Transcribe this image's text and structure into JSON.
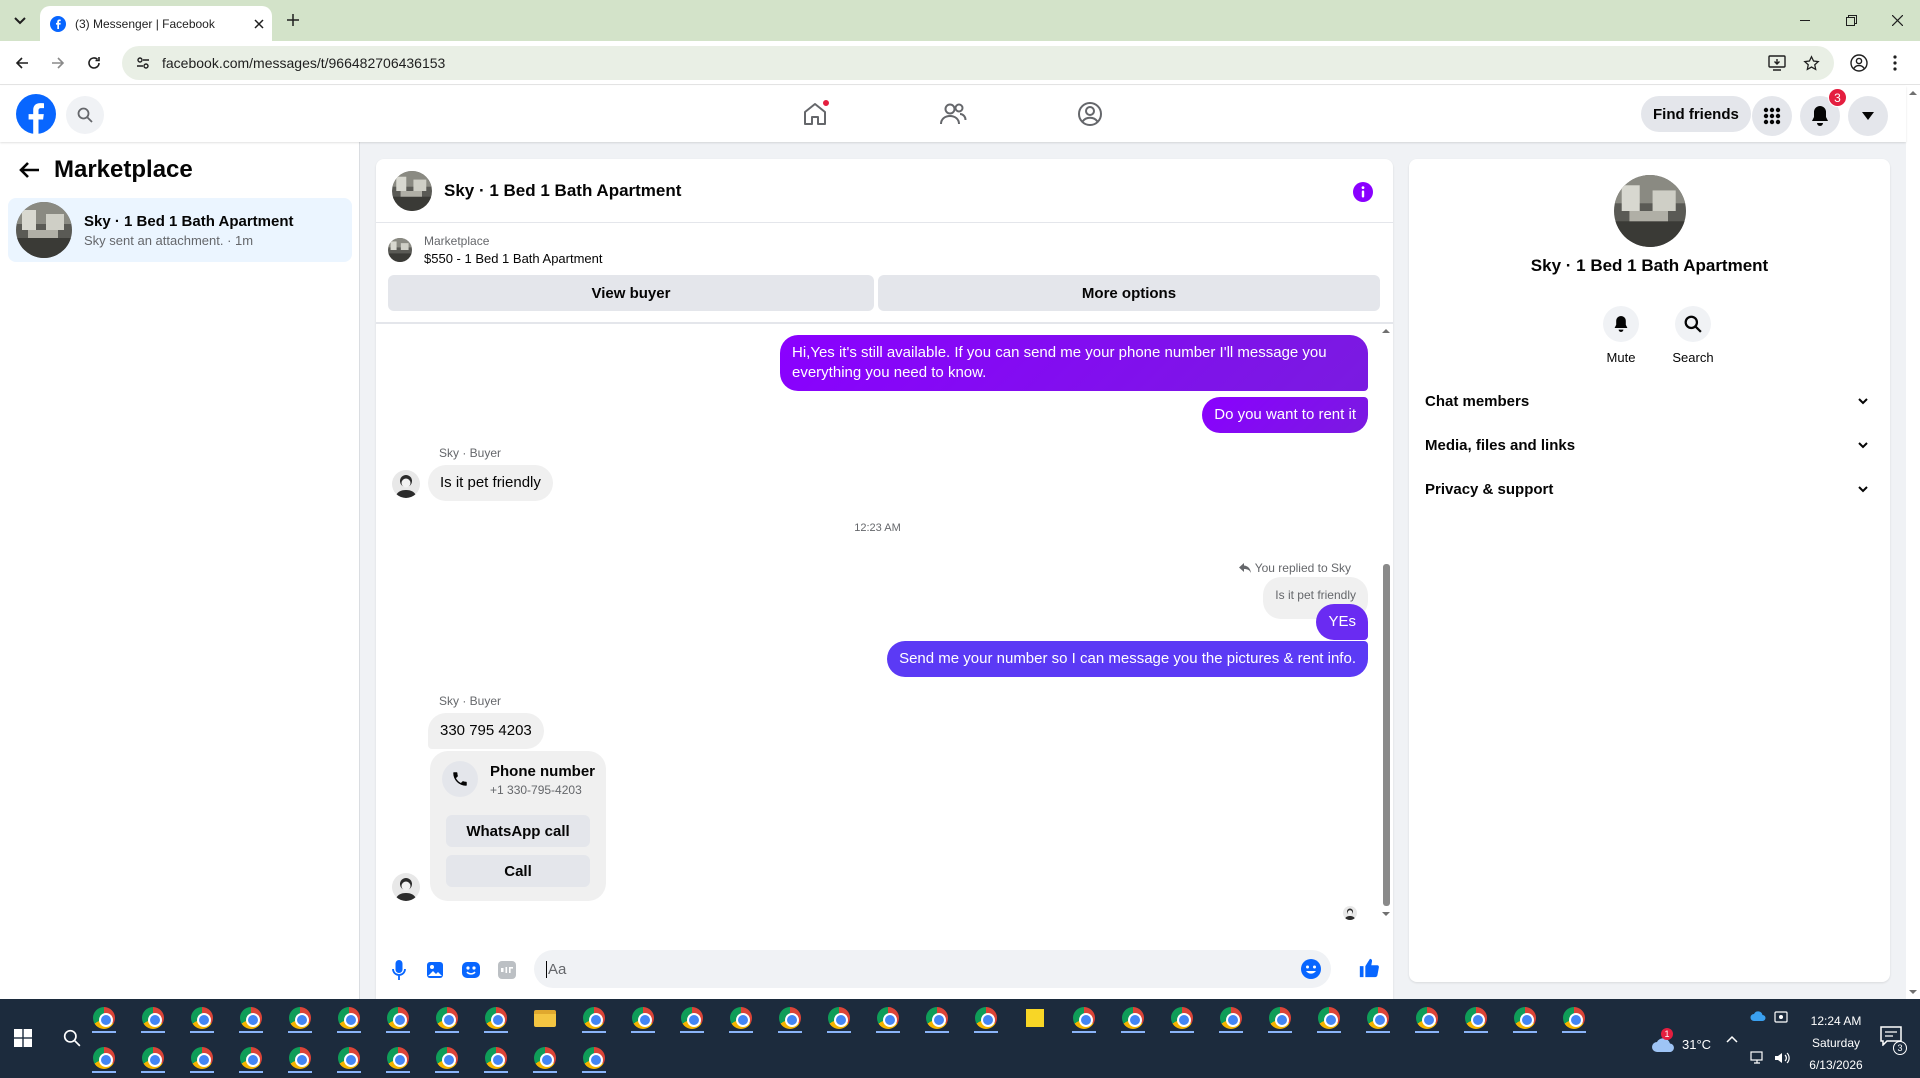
{
  "browser": {
    "tab_title": "(3) Messenger | Facebook",
    "url": "facebook.com/messages/t/966482706436153"
  },
  "header": {
    "find_friends": "Find friends",
    "notification_count": "3"
  },
  "sidebar": {
    "title": "Marketplace",
    "conversation": {
      "name": "Sky · 1 Bed 1 Bath Apartment",
      "preview": "Sky sent an attachment. · 1m"
    }
  },
  "chat": {
    "title": "Sky · 1 Bed 1 Bath Apartment",
    "marketplace_label": "Marketplace",
    "listing": "$550 - 1 Bed 1 Bath Apartment",
    "view_buyer": "View buyer",
    "more_options": "More options",
    "messages": {
      "m1_line1": "Hi,Yes it's still available. If you can send me your phone number I'll message you",
      "m1_line2": "everything you need to know.",
      "m2": "Do you want to rent it",
      "sender_1": "Sky · Buyer",
      "m3": "Is it pet friendly",
      "timestamp": "12:23 AM",
      "replied_note": "You replied to Sky",
      "quoted": "Is it pet friendly",
      "m4": "YEs",
      "m5": "Send me your number so I can message you the pictures & rent info.",
      "sender_2": "Sky · Buyer",
      "m6": "330 795 4203"
    },
    "phone_card": {
      "title": "Phone number",
      "number": "+1 330-795-4203",
      "whatsapp": "WhatsApp call",
      "call": "Call"
    },
    "composer_placeholder": "Aa"
  },
  "details": {
    "title": "Sky · 1 Bed 1 Bath Apartment",
    "mute": "Mute",
    "search": "Search",
    "sections": [
      "Chat members",
      "Media, files and links",
      "Privacy & support"
    ]
  },
  "taskbar": {
    "weather": "31°C",
    "time": "12:24 AM",
    "day": "Saturday",
    "date": "6/13/2026",
    "notif_count": "3",
    "weather_badge": "1"
  },
  "colors": {
    "fb_blue": "#0866ff",
    "messenger_purple": "#8a00ff",
    "taskbar": "#1c2b3d"
  }
}
